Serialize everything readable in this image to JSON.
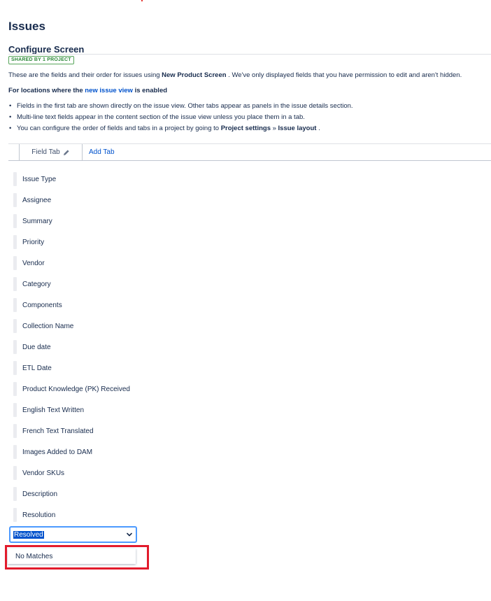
{
  "page": {
    "title": "Issues",
    "subtitle": "Configure Screen",
    "badge": "SHARED BY 1 PROJECT"
  },
  "intro": {
    "before": "These are the fields and their order for issues using ",
    "screen_name": "New Product Screen",
    "after": " . We've only displayed fields that you have permission to edit and aren't hidden."
  },
  "locations": {
    "before": "For locations where the ",
    "link": "new issue view",
    "after": " is enabled"
  },
  "bullets": {
    "b1": "Fields in the first tab are shown directly on the issue view. Other tabs appear as panels in the issue details section.",
    "b2": "Multi-line text fields appear in the content section of the issue view unless you place them in a tab.",
    "b3_before": "You can configure the order of fields and tabs in a project by going to ",
    "b3_bold1": "Project settings",
    "b3_sep": " » ",
    "b3_bold2": "Issue layout",
    "b3_after": " ."
  },
  "tabs": {
    "field_tab": "Field Tab",
    "add_tab": "Add Tab"
  },
  "icons": {
    "edit": "pencil-icon",
    "drag": "grip-handle",
    "dropdown": "chevron-down-icon"
  },
  "fields": [
    "Issue Type",
    "Assignee",
    "Summary",
    "Priority",
    "Vendor",
    "Category",
    "Components",
    "Collection Name",
    "Due date",
    "ETL Date",
    "Product Knowledge (PK) Received",
    "English Text Written",
    "French Text Translated",
    "Images Added to DAM",
    "Vendor SKUs",
    "Description",
    "Resolution"
  ],
  "field_select": {
    "value": "Resolved",
    "no_matches": "No Matches"
  },
  "colors": {
    "link": "#0052cc",
    "badge": "#2f8a3b",
    "focus": "#4c9aff",
    "highlight": "#e21b2c"
  }
}
